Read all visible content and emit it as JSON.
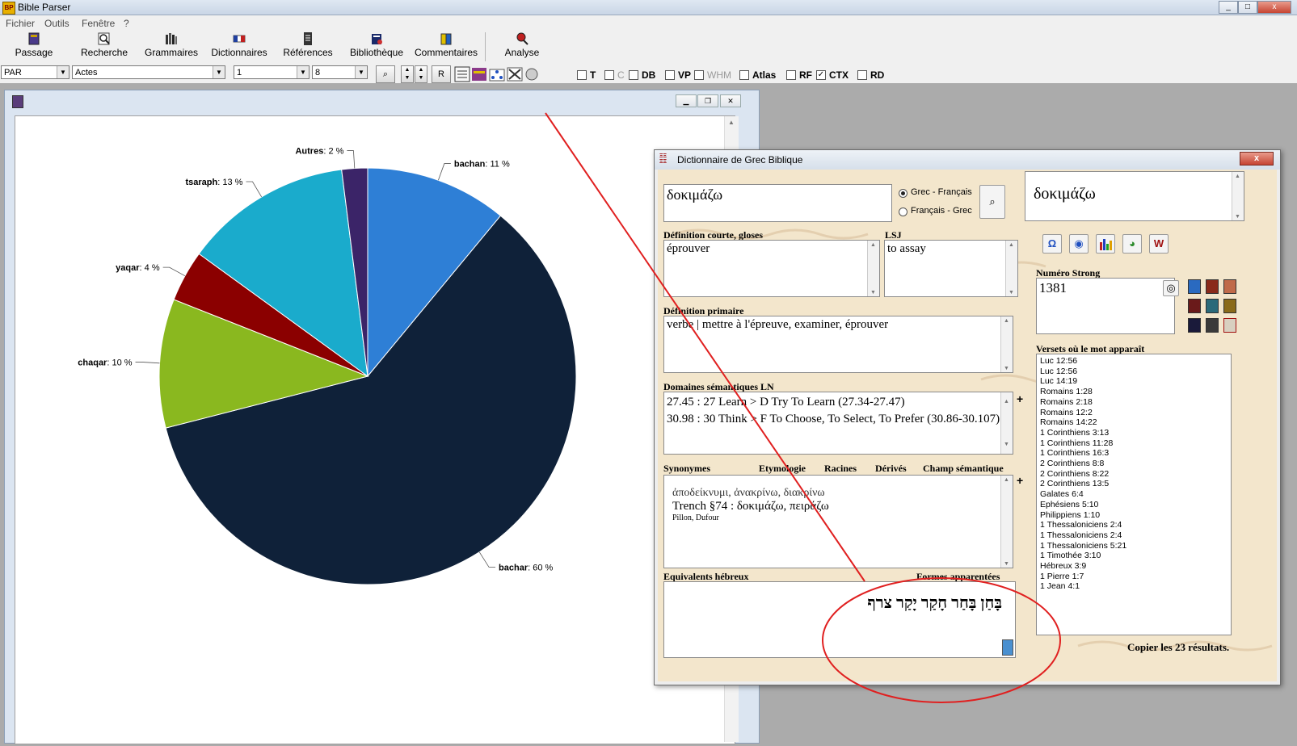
{
  "app": {
    "title": "Bible Parser"
  },
  "menu": [
    "Fichier",
    "Outils",
    "Fenêtre",
    "?"
  ],
  "toolbar": {
    "buttons": [
      "Passage",
      "Recherche",
      "Grammaires",
      "Dictionnaires",
      "Références",
      "Bibliothèque",
      "Commentaires",
      "Analyse"
    ]
  },
  "navbar": {
    "version": "PAR",
    "book": "Actes",
    "chapter": "1",
    "verse": "8",
    "r_label": "R",
    "checkboxes": [
      {
        "label": "T",
        "checked": false,
        "enabled": true
      },
      {
        "label": "C",
        "checked": false,
        "enabled": false
      },
      {
        "label": "DB",
        "checked": false,
        "enabled": true
      },
      {
        "label": "VP",
        "checked": false,
        "enabled": true
      },
      {
        "label": "WHM",
        "checked": false,
        "enabled": false
      },
      {
        "label": "Atlas",
        "checked": false,
        "enabled": true
      },
      {
        "label": "RF",
        "checked": false,
        "enabled": true
      },
      {
        "label": "CTX",
        "checked": true,
        "enabled": true
      },
      {
        "label": "RD",
        "checked": false,
        "enabled": true
      }
    ]
  },
  "chart_data": {
    "type": "pie",
    "slices": [
      {
        "label": "bachan",
        "value": 11,
        "pct_text": "11 %",
        "color": "#2e7fd6"
      },
      {
        "label": "bachar",
        "value": 60,
        "pct_text": "60 %",
        "color": "#0f2139"
      },
      {
        "label": "chaqar",
        "value": 10,
        "pct_text": "10 %",
        "color": "#8ab81f"
      },
      {
        "label": "yaqar",
        "value": 4,
        "pct_text": "4 %",
        "color": "#8b0000"
      },
      {
        "label": "tsaraph",
        "value": 13,
        "pct_text": "13 %",
        "color": "#1aabcc"
      },
      {
        "label": "Autres",
        "value": 2,
        "pct_text": "2 %",
        "color": "#3b2468"
      }
    ]
  },
  "dict": {
    "title": "Dictionnaire de Grec Biblique",
    "close": "x",
    "search_value": "δοκιμάζω",
    "radio1": "Grec - Français",
    "radio2": "Français - Grec",
    "headword": "δοκιμάζω",
    "short_def_label": "Définition courte, gloses",
    "short_def": "éprouver",
    "lsj_label": "LSJ",
    "lsj": "to assay",
    "strong_label": "Numéro Strong",
    "strong": "1381",
    "primary_label": "Définition primaire",
    "primary": "verbe  | mettre à l'épreuve, examiner, éprouver",
    "domains_label": "Domaines sémantiques LN",
    "domains": [
      "27.45 : 27 Learn > D Try To Learn (27.34-27.47)",
      "30.98 : 30 Think > F To Choose, To Select, To Prefer (30.86-30.107)"
    ],
    "tabs": [
      "Synonymes",
      "Etymologie",
      "Racines",
      "Dérivés",
      "Champ sémantique"
    ],
    "synonyms": {
      "line1": "ἀποδείκνυμι, ἀνακρίνω, διακρίνω",
      "line2": "Trench §74 : δοκιμάζω, πειράζω",
      "line3": "Pillon, Dufour"
    },
    "heb_label": "Equivalents hébreux",
    "forms_label": "Formes apparentées",
    "hebrew": "בָּחַן בָּחַר חָקַר יָקַר צרף",
    "verses_label": "Versets où le mot apparaît",
    "verses": [
      "Luc 12:56",
      "Luc 12:56",
      "Luc 14:19",
      "Romains 1:28",
      "Romains 2:18",
      "Romains 12:2",
      "Romains 14:22",
      "1 Corinthiens 3:13",
      "1 Corinthiens 11:28",
      "1 Corinthiens 16:3",
      "2 Corinthiens 8:8",
      "2 Corinthiens 8:22",
      "2 Corinthiens 13:5",
      "Galates 6:4",
      "Ephésiens 5:10",
      "Philippiens 1:10",
      "1 Thessaloniciens 2:4",
      "1 Thessaloniciens 2:4",
      "1 Thessaloniciens 5:21",
      "1 Timothée 3:10",
      "Hébreux 3:9",
      "1 Pierre 1:7",
      "1 Jean 4:1"
    ],
    "copy_label": "Copier les 23 résultats."
  },
  "colors": {
    "annotation": "#e02020",
    "parchment": "#f3e6cc"
  }
}
